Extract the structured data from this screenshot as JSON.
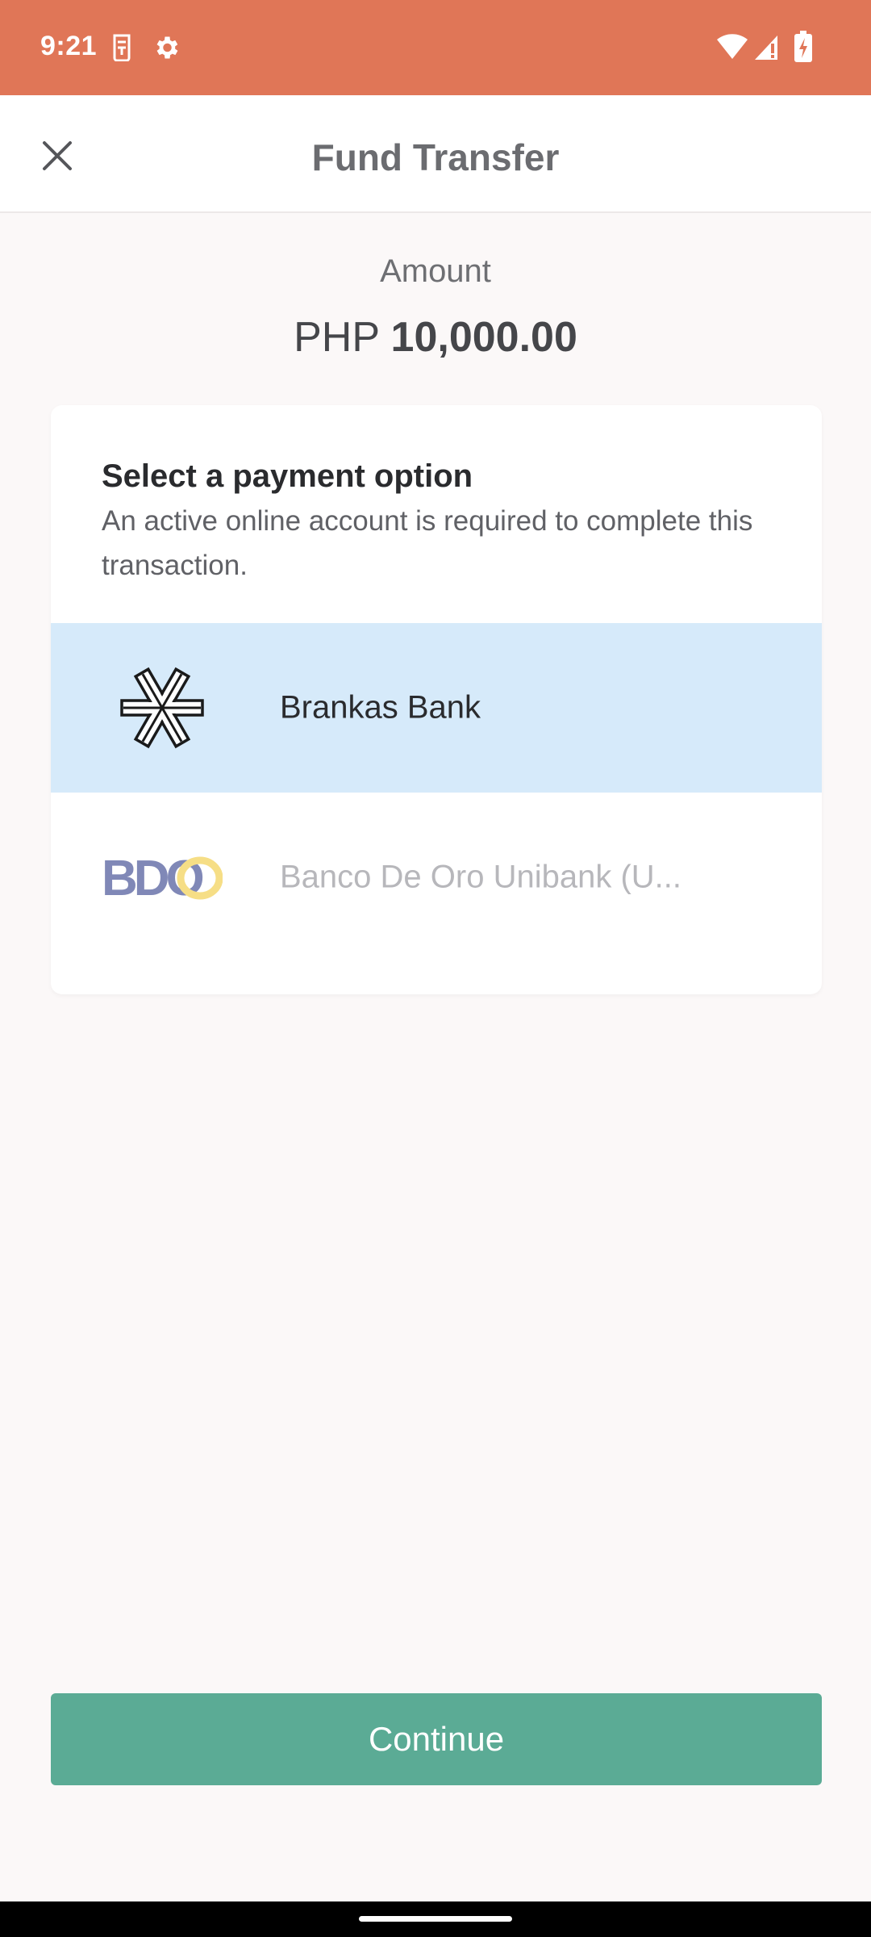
{
  "status_bar": {
    "time": "9:21",
    "color": "#e07657",
    "left_icons": [
      "sim-card-icon",
      "gear-icon"
    ],
    "right_icons": [
      "wifi-icon",
      "signal-icon",
      "battery-charging-icon"
    ]
  },
  "app_bar": {
    "title": "Fund Transfer",
    "close_icon": "close-icon"
  },
  "amount": {
    "label": "Amount",
    "currency": "PHP",
    "value": "10,000.00"
  },
  "payment": {
    "heading": "Select a payment option",
    "subtext": "An active online account is required to complete this transaction.",
    "options": [
      {
        "label": "Brankas Bank",
        "state": "selected",
        "logo": "brankas-logo-icon"
      },
      {
        "label": "Banco De Oro Unibank (U...",
        "state": "disabled",
        "logo": "bdo-logo-icon",
        "logo_text": "BDO"
      }
    ]
  },
  "continue_label": "Continue",
  "colors": {
    "accent": "#5bab95",
    "header": "#e07657",
    "selected_option": "#d6eafa"
  }
}
